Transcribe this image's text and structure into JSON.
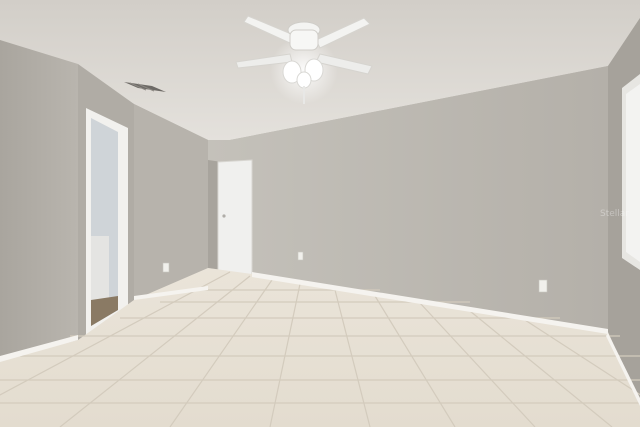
{
  "photo": {
    "kind": "interior-room-photo",
    "watermark": "Stellar",
    "colors": {
      "ceiling": "#dedbd5",
      "wall_light": "#c2bfb8",
      "wall_mid": "#b3afa8",
      "wall_shadow": "#a29e97",
      "floor_tile": "#ece6dc",
      "grout": "#cfc7ba",
      "baseboard": "#f4f2ee",
      "door": "#eeeeec",
      "fan": "#f2f2f0"
    },
    "objects": [
      "ceiling",
      "ceiling-fan-icon",
      "air-vent-icon",
      "left-wall",
      "bathroom-doorway",
      "hallway-door",
      "back-wall",
      "right-window-opening",
      "electrical-outlet-icon",
      "baseboard",
      "tile-floor"
    ]
  }
}
